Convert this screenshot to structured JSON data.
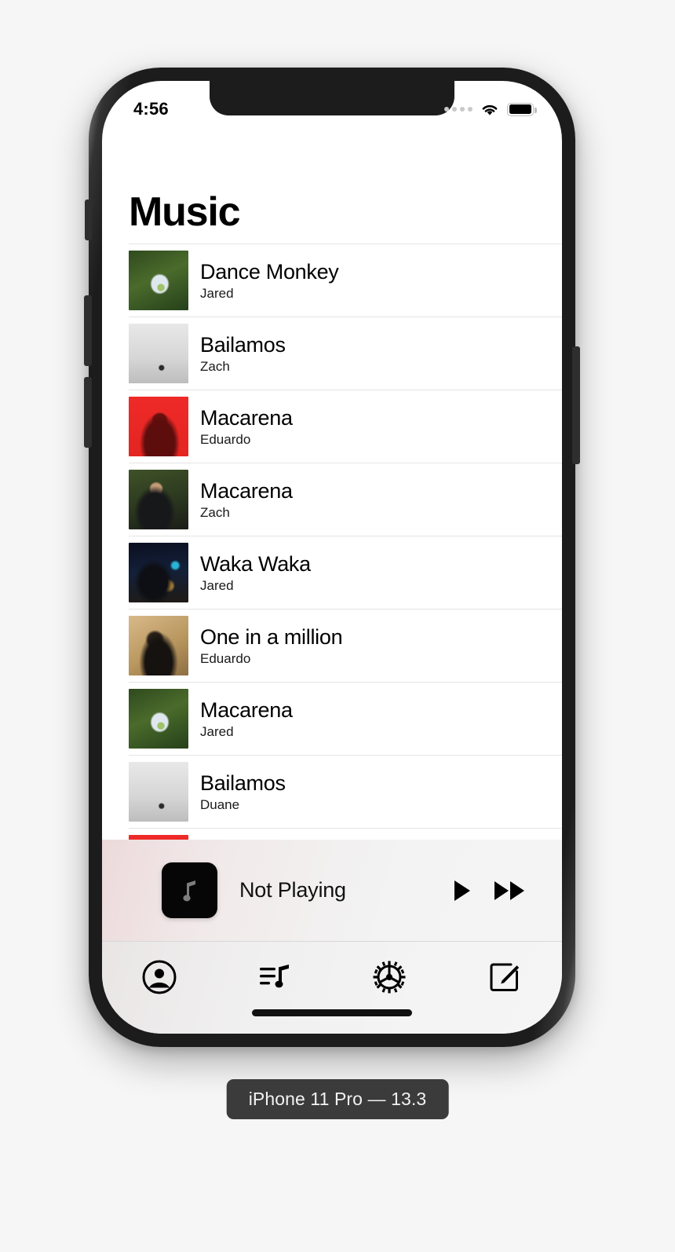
{
  "status_bar": {
    "time": "4:56",
    "cellular_icon": "cellular-dots-icon",
    "wifi_icon": "wifi-icon",
    "battery_icon": "battery-full-icon"
  },
  "header": {
    "title": "Music"
  },
  "songs": [
    {
      "title": "Dance Monkey",
      "artist": "Jared",
      "art": "art-grass"
    },
    {
      "title": "Bailamos",
      "artist": "Zach",
      "art": "art-bw"
    },
    {
      "title": "Macarena",
      "artist": "Eduardo",
      "art": "art-red"
    },
    {
      "title": "Macarena",
      "artist": "Zach",
      "art": "art-portrait"
    },
    {
      "title": "Waka Waka",
      "artist": "Jared",
      "art": "art-city"
    },
    {
      "title": "One in a million",
      "artist": "Eduardo",
      "art": "art-sepia"
    },
    {
      "title": "Macarena",
      "artist": "Jared",
      "art": "art-grass"
    },
    {
      "title": "Bailamos",
      "artist": "Duane",
      "art": "art-bw"
    },
    {
      "title": "",
      "artist": "",
      "art": "art-red"
    }
  ],
  "mini_player": {
    "status_text": "Not Playing",
    "artwork_icon": "music-note-icon",
    "play_label": "play-icon",
    "forward_label": "fast-forward-icon"
  },
  "tab_bar": {
    "items": [
      {
        "icon": "person-circle-icon"
      },
      {
        "icon": "music-list-icon"
      },
      {
        "icon": "gear-icon"
      },
      {
        "icon": "compose-icon"
      }
    ]
  },
  "caption": {
    "text": "iPhone 11 Pro — 13.3"
  },
  "colors": {
    "accent_red": "#ee2a28",
    "page_background": "#f6f6f6",
    "frame": "#1c1c1c",
    "separator": "#e4e4e4"
  }
}
